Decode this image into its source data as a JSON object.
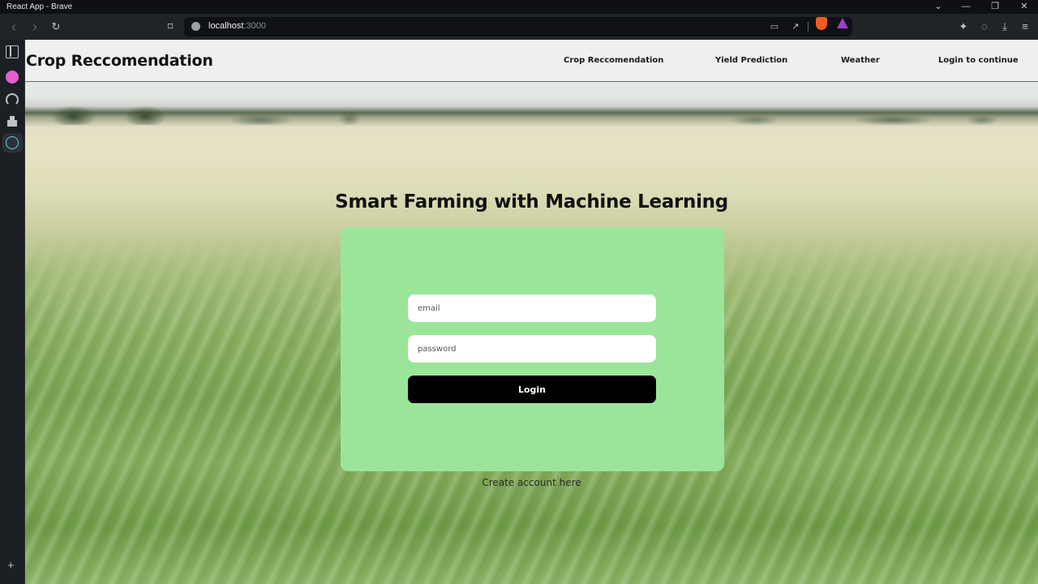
{
  "window": {
    "title": "React App - Brave",
    "controls": {
      "tabs_menu": "⌄",
      "minimize": "—",
      "restore": "❐",
      "close": "✕"
    }
  },
  "browser": {
    "url_host": "localhost",
    "url_port": ":3000",
    "icons": {
      "back": "‹",
      "forward": "›",
      "reload": "↻",
      "bookmark": "⌑",
      "cast": "▭",
      "share": "↗",
      "extensions": "✦",
      "leo": "◌",
      "downloads": "⤓",
      "menu": "≡"
    }
  },
  "sidebar": {
    "items": [
      {
        "name": "sidebar-panel",
        "color": "#bfc3c8"
      },
      {
        "name": "pink-extension",
        "color": "#e35fcf"
      },
      {
        "name": "speed-dial",
        "color": "#bfc3c8"
      },
      {
        "name": "wallet",
        "color": "#bfc3c8"
      },
      {
        "name": "react-devtools",
        "color": "#5fd0e6"
      }
    ],
    "add_label": "+"
  },
  "navbar": {
    "brand": "Crop Reccomendation",
    "links": [
      "Crop Reccomendation",
      "Yield Prediction",
      "Weather",
      "Login to continue"
    ]
  },
  "main": {
    "headline": "Smart Farming with Machine Learning",
    "form": {
      "email_placeholder": "email",
      "email_value": "",
      "password_placeholder": "password",
      "password_value": "",
      "login_label": "Login"
    },
    "create_account": "Create account here"
  },
  "colors": {
    "card": "#9be59a",
    "button": "#000000"
  }
}
